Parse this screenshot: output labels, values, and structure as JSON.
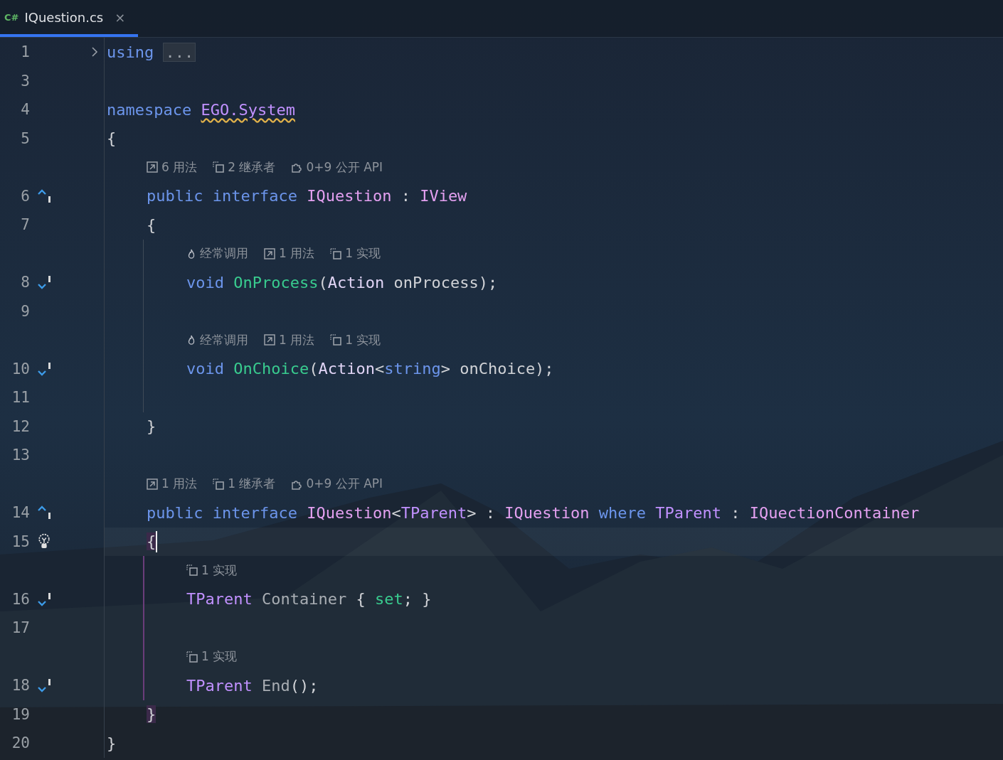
{
  "tab": {
    "icon_text": "C#",
    "title": "IQuestion.cs",
    "close": "×",
    "selected": true
  },
  "rows": [
    {
      "kind": "code",
      "number": "1",
      "marker": {
        "kind": "fold"
      },
      "tokens": [
        {
          "text": "using ",
          "kind": "keyword"
        },
        {
          "text": "...",
          "kind": "folded"
        }
      ]
    },
    {
      "kind": "code",
      "number": "3"
    },
    {
      "kind": "code",
      "number": "4",
      "tokens": [
        {
          "text": "namespace ",
          "kind": "keyword"
        },
        {
          "text": "EGO.System",
          "kind": "namespace"
        }
      ]
    },
    {
      "kind": "code",
      "number": "5",
      "tokens": [
        {
          "text": "{",
          "kind": "plain"
        }
      ],
      "children": [
        {
          "kind": "hints",
          "hints": [
            {
              "kind": "usages",
              "text": "6 用法"
            },
            {
              "kind": "inheritors",
              "text": "2 继承者"
            },
            {
              "kind": "api",
              "text": "0+9 公开 API"
            }
          ]
        },
        {
          "kind": "code",
          "number": "6",
          "marker": {
            "kind": "up"
          },
          "tokens": [
            {
              "text": "public ",
              "kind": "keyword"
            },
            {
              "text": "interface ",
              "kind": "keyword"
            },
            {
              "text": "IQuestion",
              "kind": "interface"
            },
            {
              "text": " : ",
              "kind": "plain"
            },
            {
              "text": "IView",
              "kind": "interface"
            }
          ]
        },
        {
          "kind": "code",
          "number": "7",
          "tokens": [
            {
              "text": "{",
              "kind": "plain"
            }
          ],
          "children": [
            {
              "kind": "hints",
              "hints": [
                {
                  "kind": "hot",
                  "text": "经常调用"
                },
                {
                  "kind": "usages",
                  "text": "1 用法"
                },
                {
                  "kind": "impl",
                  "text": "1 实现"
                }
              ]
            },
            {
              "kind": "code",
              "number": "8",
              "marker": {
                "kind": "down"
              },
              "tokens": [
                {
                  "text": "void ",
                  "kind": "keyword"
                },
                {
                  "text": "OnProcess",
                  "kind": "method"
                },
                {
                  "text": "(",
                  "kind": "plain"
                },
                {
                  "text": "Action",
                  "kind": "type"
                },
                {
                  "text": " onProcess);",
                  "kind": "plain"
                }
              ]
            },
            {
              "kind": "code",
              "number": "9"
            },
            {
              "kind": "hints",
              "hints": [
                {
                  "kind": "hot",
                  "text": "经常调用"
                },
                {
                  "kind": "usages",
                  "text": "1 用法"
                },
                {
                  "kind": "impl",
                  "text": "1 实现"
                }
              ]
            },
            {
              "kind": "code",
              "number": "10",
              "marker": {
                "kind": "down"
              },
              "tokens": [
                {
                  "text": "void ",
                  "kind": "keyword"
                },
                {
                  "text": "OnChoice",
                  "kind": "method"
                },
                {
                  "text": "(",
                  "kind": "plain"
                },
                {
                  "text": "Action",
                  "kind": "type"
                },
                {
                  "text": "<",
                  "kind": "plain"
                },
                {
                  "text": "string",
                  "kind": "keyword"
                },
                {
                  "text": "> onChoice);",
                  "kind": "plain"
                }
              ]
            },
            {
              "kind": "code",
              "number": "11"
            }
          ]
        },
        {
          "kind": "code",
          "number": "12",
          "tokens": [
            {
              "text": "}",
              "kind": "plain"
            }
          ]
        },
        {
          "kind": "code",
          "number": "13"
        },
        {
          "kind": "hints",
          "hints": [
            {
              "kind": "usages",
              "text": "1 用法"
            },
            {
              "kind": "inheritors",
              "text": "1 继承者"
            },
            {
              "kind": "api",
              "text": "0+9 公开 API"
            }
          ]
        },
        {
          "kind": "code",
          "number": "14",
          "marker": {
            "kind": "up"
          },
          "tokens": [
            {
              "text": "public ",
              "kind": "keyword"
            },
            {
              "text": "interface ",
              "kind": "keyword"
            },
            {
              "text": "IQuestion",
              "kind": "interface"
            },
            {
              "text": "<",
              "kind": "plain"
            },
            {
              "text": "TParent",
              "kind": "tparam"
            },
            {
              "text": "> : ",
              "kind": "plain"
            },
            {
              "text": "IQuestion ",
              "kind": "interface"
            },
            {
              "text": "where ",
              "kind": "keyword"
            },
            {
              "text": "TParent",
              "kind": "tparam"
            },
            {
              "text": " : ",
              "kind": "plain"
            },
            {
              "text": "IQuectionContainer",
              "kind": "interface"
            }
          ]
        },
        {
          "kind": "code",
          "number": "15",
          "marker": {
            "kind": "bulb"
          },
          "caret": true,
          "tokens": [
            {
              "text": "{",
              "kind": "brace-match"
            }
          ],
          "children": [
            {
              "kind": "hints",
              "hints": [
                {
                  "kind": "impl",
                  "text": "1 实现"
                }
              ]
            },
            {
              "kind": "code",
              "number": "16",
              "marker": {
                "kind": "down"
              },
              "tokens": [
                {
                  "text": "TParent ",
                  "kind": "tparam"
                },
                {
                  "text": "Container",
                  "kind": "property"
                },
                {
                  "text": " { ",
                  "kind": "plain"
                },
                {
                  "text": "set",
                  "kind": "method"
                },
                {
                  "text": "; }",
                  "kind": "plain"
                }
              ]
            },
            {
              "kind": "code",
              "number": "17"
            },
            {
              "kind": "hints",
              "hints": [
                {
                  "kind": "impl",
                  "text": "1 实现"
                }
              ]
            },
            {
              "kind": "code",
              "number": "18",
              "marker": {
                "kind": "down"
              },
              "tokens": [
                {
                  "text": "TParent ",
                  "kind": "tparam"
                },
                {
                  "text": "End",
                  "kind": "property"
                },
                {
                  "text": "();",
                  "kind": "plain"
                }
              ]
            }
          ]
        },
        {
          "kind": "code",
          "number": "19",
          "tokens": [
            {
              "text": "}",
              "kind": "brace-match"
            }
          ]
        }
      ]
    },
    {
      "kind": "code",
      "number": "20",
      "tokens": [
        {
          "text": "}",
          "kind": "plain"
        }
      ]
    }
  ]
}
